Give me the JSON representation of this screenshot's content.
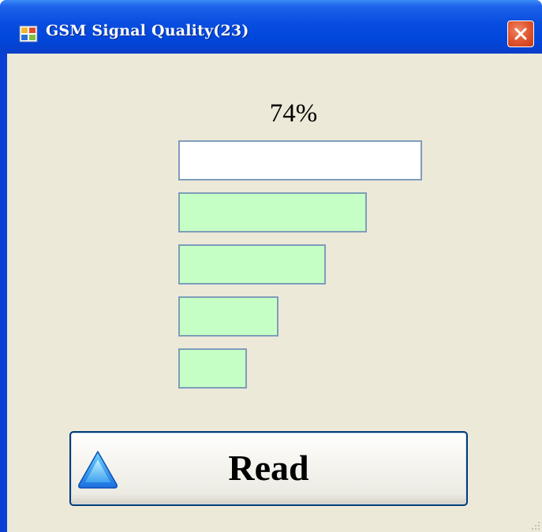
{
  "window": {
    "title": "GSM Signal Quality(23)",
    "icon": "app-window-icon",
    "close_icon": "close-icon"
  },
  "signal": {
    "percent_text": "74%",
    "bars_total": 5,
    "bars_filled": 4,
    "fill_color": "#c6ffc6",
    "empty_color": "#ffffff"
  },
  "read_button": {
    "label": "Read",
    "icon": "triangle-up-icon"
  },
  "colors": {
    "titlebar": "#0a4fe0",
    "client_background": "#ece9d8",
    "close_button": "#e0562f"
  }
}
